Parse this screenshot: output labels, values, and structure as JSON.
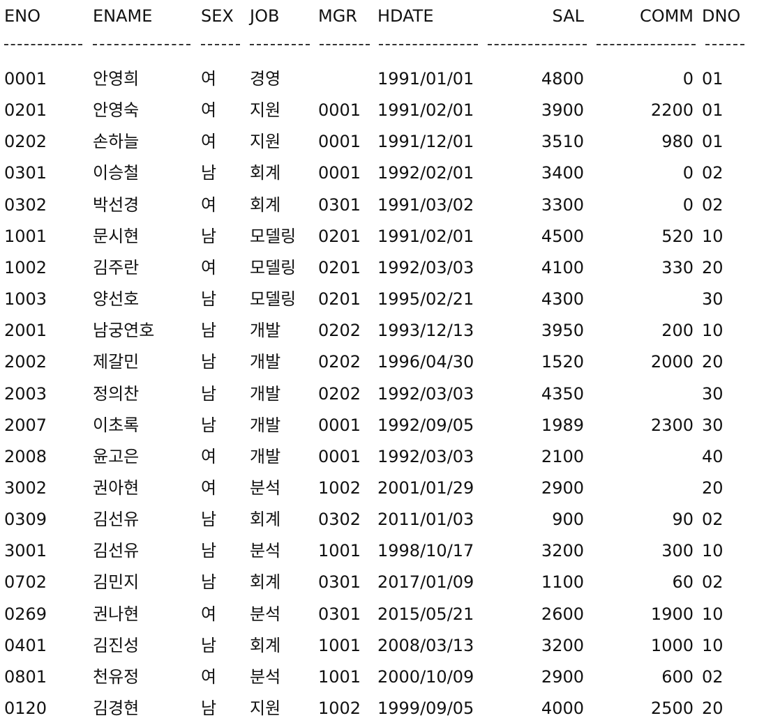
{
  "columns": {
    "eno": "ENO",
    "ename": "ENAME",
    "sex": "SEX",
    "job": "JOB",
    "mgr": "MGR",
    "hdate": "HDATE",
    "sal": "SAL",
    "comm": "COMM",
    "dno": "DNO"
  },
  "rows": [
    {
      "eno": "0001",
      "ename": "안영희",
      "sex": "여",
      "job": "경영",
      "mgr": "",
      "hdate": "1991/01/01",
      "sal": "4800",
      "comm": "0",
      "dno": "01"
    },
    {
      "eno": "0201",
      "ename": "안영숙",
      "sex": "여",
      "job": "지원",
      "mgr": "0001",
      "hdate": "1991/02/01",
      "sal": "3900",
      "comm": "2200",
      "dno": "01"
    },
    {
      "eno": "0202",
      "ename": "손하늘",
      "sex": "여",
      "job": "지원",
      "mgr": "0001",
      "hdate": "1991/12/01",
      "sal": "3510",
      "comm": "980",
      "dno": "01"
    },
    {
      "eno": "0301",
      "ename": "이승철",
      "sex": "남",
      "job": "회계",
      "mgr": "0001",
      "hdate": "1992/02/01",
      "sal": "3400",
      "comm": "0",
      "dno": "02"
    },
    {
      "eno": "0302",
      "ename": "박선경",
      "sex": "여",
      "job": "회계",
      "mgr": "0301",
      "hdate": "1991/03/02",
      "sal": "3300",
      "comm": "0",
      "dno": "02"
    },
    {
      "eno": "1001",
      "ename": "문시현",
      "sex": "남",
      "job": "모델링",
      "mgr": "0201",
      "hdate": "1991/02/01",
      "sal": "4500",
      "comm": "520",
      "dno": "10"
    },
    {
      "eno": "1002",
      "ename": "김주란",
      "sex": "여",
      "job": "모델링",
      "mgr": "0201",
      "hdate": "1992/03/03",
      "sal": "4100",
      "comm": "330",
      "dno": "20"
    },
    {
      "eno": "1003",
      "ename": "양선호",
      "sex": "남",
      "job": "모델링",
      "mgr": "0201",
      "hdate": "1995/02/21",
      "sal": "4300",
      "comm": "",
      "dno": "30"
    },
    {
      "eno": "2001",
      "ename": "남궁연호",
      "sex": "남",
      "job": "개발",
      "mgr": "0202",
      "hdate": "1993/12/13",
      "sal": "3950",
      "comm": "200",
      "dno": "10"
    },
    {
      "eno": "2002",
      "ename": "제갈민",
      "sex": "남",
      "job": "개발",
      "mgr": "0202",
      "hdate": "1996/04/30",
      "sal": "1520",
      "comm": "2000",
      "dno": "20"
    },
    {
      "eno": "2003",
      "ename": "정의찬",
      "sex": "남",
      "job": "개발",
      "mgr": "0202",
      "hdate": "1992/03/03",
      "sal": "4350",
      "comm": "",
      "dno": "30"
    },
    {
      "eno": "2007",
      "ename": "이초록",
      "sex": "남",
      "job": "개발",
      "mgr": "0001",
      "hdate": "1992/09/05",
      "sal": "1989",
      "comm": "2300",
      "dno": "30"
    },
    {
      "eno": "2008",
      "ename": "윤고은",
      "sex": "여",
      "job": "개발",
      "mgr": "0001",
      "hdate": "1992/03/03",
      "sal": "2100",
      "comm": "",
      "dno": "40"
    },
    {
      "eno": "3002",
      "ename": "권아현",
      "sex": "여",
      "job": "분석",
      "mgr": "1002",
      "hdate": "2001/01/29",
      "sal": "2900",
      "comm": "",
      "dno": "20"
    },
    {
      "eno": "0309",
      "ename": "김선유",
      "sex": "남",
      "job": "회계",
      "mgr": "0302",
      "hdate": "2011/01/03",
      "sal": "900",
      "comm": "90",
      "dno": "02"
    },
    {
      "eno": "3001",
      "ename": "김선유",
      "sex": "남",
      "job": "분석",
      "mgr": "1001",
      "hdate": "1998/10/17",
      "sal": "3200",
      "comm": "300",
      "dno": "10"
    },
    {
      "eno": "0702",
      "ename": "김민지",
      "sex": "남",
      "job": "회계",
      "mgr": "0301",
      "hdate": "2017/01/09",
      "sal": "1100",
      "comm": "60",
      "dno": "02"
    },
    {
      "eno": "0269",
      "ename": "권나현",
      "sex": "여",
      "job": "분석",
      "mgr": "0301",
      "hdate": "2015/05/21",
      "sal": "2600",
      "comm": "1900",
      "dno": "10"
    },
    {
      "eno": "0401",
      "ename": "김진성",
      "sex": "남",
      "job": "회계",
      "mgr": "1001",
      "hdate": "2008/03/13",
      "sal": "3200",
      "comm": "1000",
      "dno": "10"
    },
    {
      "eno": "0801",
      "ename": "천유정",
      "sex": "여",
      "job": "분석",
      "mgr": "1001",
      "hdate": "2000/10/09",
      "sal": "2900",
      "comm": "600",
      "dno": "02"
    },
    {
      "eno": "0120",
      "ename": "김경현",
      "sex": "남",
      "job": "지원",
      "mgr": "1002",
      "hdate": "1999/09/05",
      "sal": "4000",
      "comm": "2500",
      "dno": "20"
    }
  ]
}
